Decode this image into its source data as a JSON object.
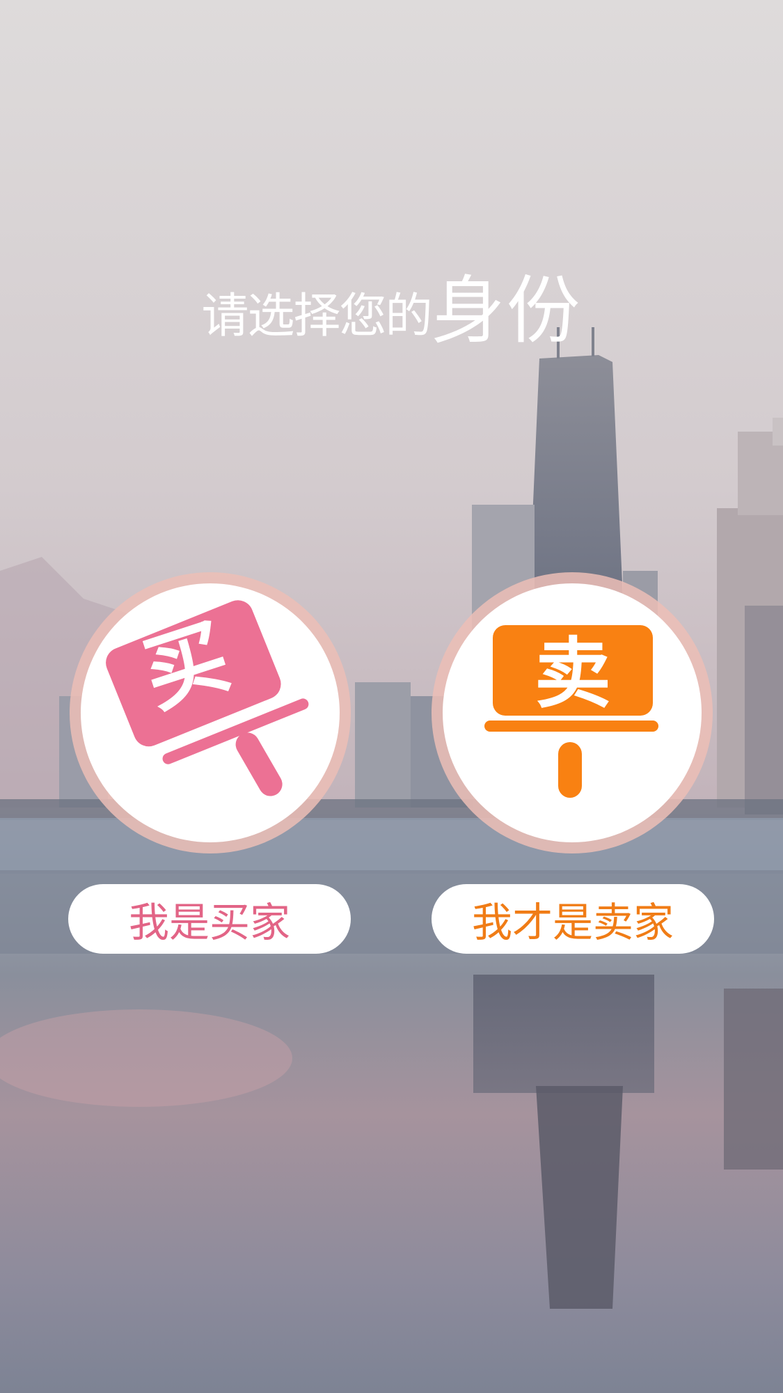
{
  "title": {
    "prefix": "请选择您的",
    "emphasis": "身份"
  },
  "buyer": {
    "sign_char": "买",
    "button_label": "我是买家",
    "color": "#ec7194"
  },
  "seller": {
    "sign_char": "卖",
    "button_label": "我才是卖家",
    "color": "#f98112"
  }
}
